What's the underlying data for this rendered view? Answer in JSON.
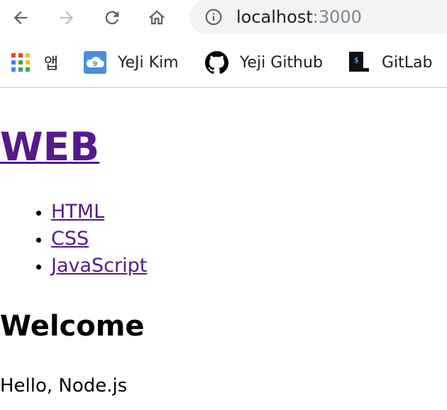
{
  "browser": {
    "nav": {
      "back_icon": "arrow-back-icon",
      "forward_icon": "arrow-forward-icon",
      "reload_icon": "reload-icon",
      "home_icon": "home-icon"
    },
    "address_bar": {
      "host": "localhost",
      "port": ":3000"
    },
    "bookmarks": [
      {
        "label": "앱",
        "icon": "apps-grid-icon"
      },
      {
        "label": "YeJi Kim",
        "icon": "cloud-icon"
      },
      {
        "label": "Yeji Github",
        "icon": "github-icon"
      },
      {
        "label": "GitLab",
        "icon": "terminal-icon"
      }
    ]
  },
  "page": {
    "title": "WEB",
    "topics": [
      "HTML",
      "CSS",
      "JavaScript"
    ],
    "heading": "Welcome",
    "body": "Hello, Node.js"
  },
  "colors": {
    "link_visited": "#551a8b",
    "omnibox_bg": "#f1f3f4",
    "port_text": "#80868b"
  }
}
